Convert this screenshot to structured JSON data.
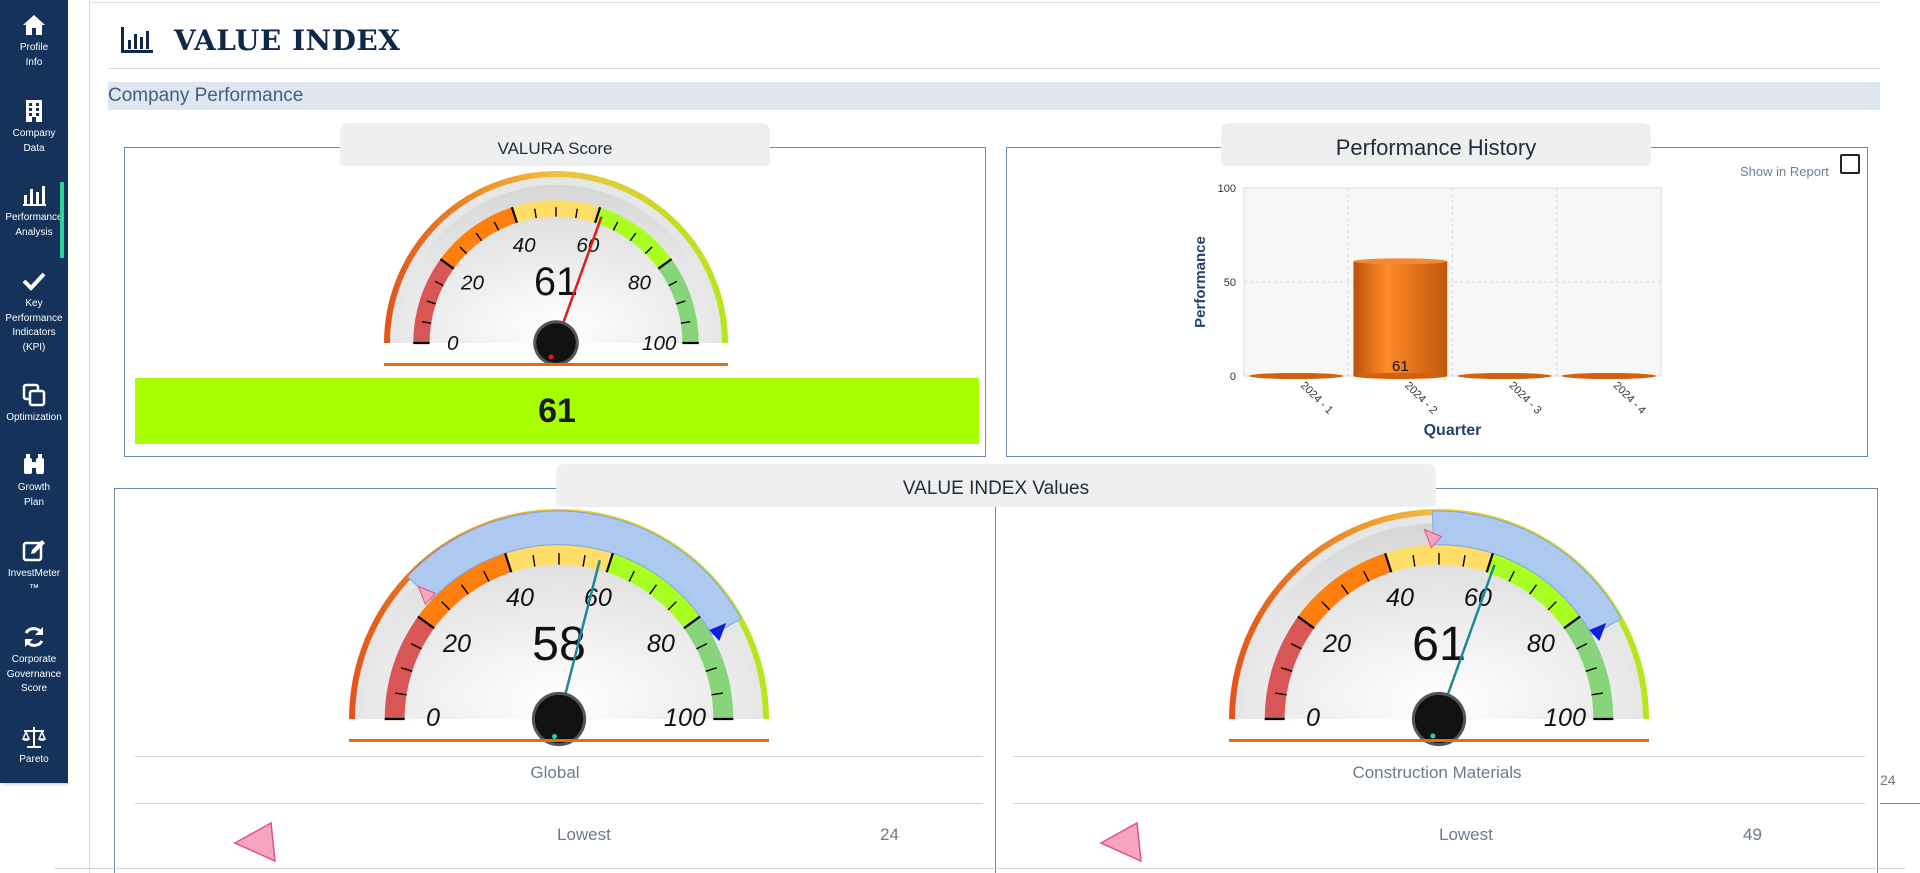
{
  "sidebar": {
    "items": [
      {
        "label": "Profile\nInfo",
        "icon": "home-icon"
      },
      {
        "label": "Company\nData",
        "icon": "building-icon"
      },
      {
        "label": "Performance\nAnalysis",
        "icon": "bar-chart-icon",
        "active": true
      },
      {
        "label": "Key\nPerformance\nIndicators\n(KPI)",
        "icon": "check-icon"
      },
      {
        "label": "Optimization",
        "icon": "copy-icon"
      },
      {
        "label": "Growth\nPlan",
        "icon": "binoculars-icon"
      },
      {
        "label": "InvestMeter\n™",
        "icon": "edit-icon"
      },
      {
        "label": "Corporate\nGovernance\nScore",
        "icon": "refresh-icon"
      },
      {
        "label": "Pareto",
        "icon": "scale-icon"
      }
    ]
  },
  "header": {
    "title": "VALUE INDEX",
    "title_icon": "bar-chart-icon"
  },
  "section": {
    "title": "Company Performance"
  },
  "valura": {
    "tab": "VALURA Score",
    "gauge": {
      "value": 61,
      "min": 0,
      "max": 100,
      "ticks": [
        "0",
        "20",
        "40",
        "60",
        "80",
        "100"
      ]
    },
    "score_text": "61",
    "score_color": "#a8ff00"
  },
  "history": {
    "tab": "Performance History",
    "show_in_report": "Show in Report",
    "chart_data": {
      "type": "bar",
      "categories": [
        "2024 - 1",
        "2024 - 2",
        "2024 - 3",
        "2024 - 4"
      ],
      "values": [
        0,
        61,
        0,
        0
      ],
      "data_labels": [
        "",
        "61",
        "",
        ""
      ],
      "title": "",
      "xlabel": "Quarter",
      "ylabel": "Performance",
      "ylim": [
        0,
        100
      ],
      "yticks": [
        "0",
        "50",
        "100"
      ],
      "grid": true,
      "color": "#e86a0c"
    }
  },
  "values": {
    "tab": "VALUE INDEX Values",
    "gauges": [
      {
        "value": 58,
        "value_text": "58",
        "range_low": 24,
        "range_high": 84,
        "category": "Global",
        "lowest_label": "Lowest",
        "lowest_value": "24",
        "ticks": [
          "0",
          "20",
          "40",
          "60",
          "80",
          "100"
        ]
      },
      {
        "value": 61,
        "value_text": "61",
        "range_low": 49,
        "range_high": 84,
        "category": "Construction Materials",
        "lowest_label": "Lowest",
        "lowest_value": "49",
        "ticks": [
          "0",
          "20",
          "40",
          "60",
          "80",
          "100"
        ]
      }
    ]
  },
  "edge": {
    "number": "24"
  }
}
